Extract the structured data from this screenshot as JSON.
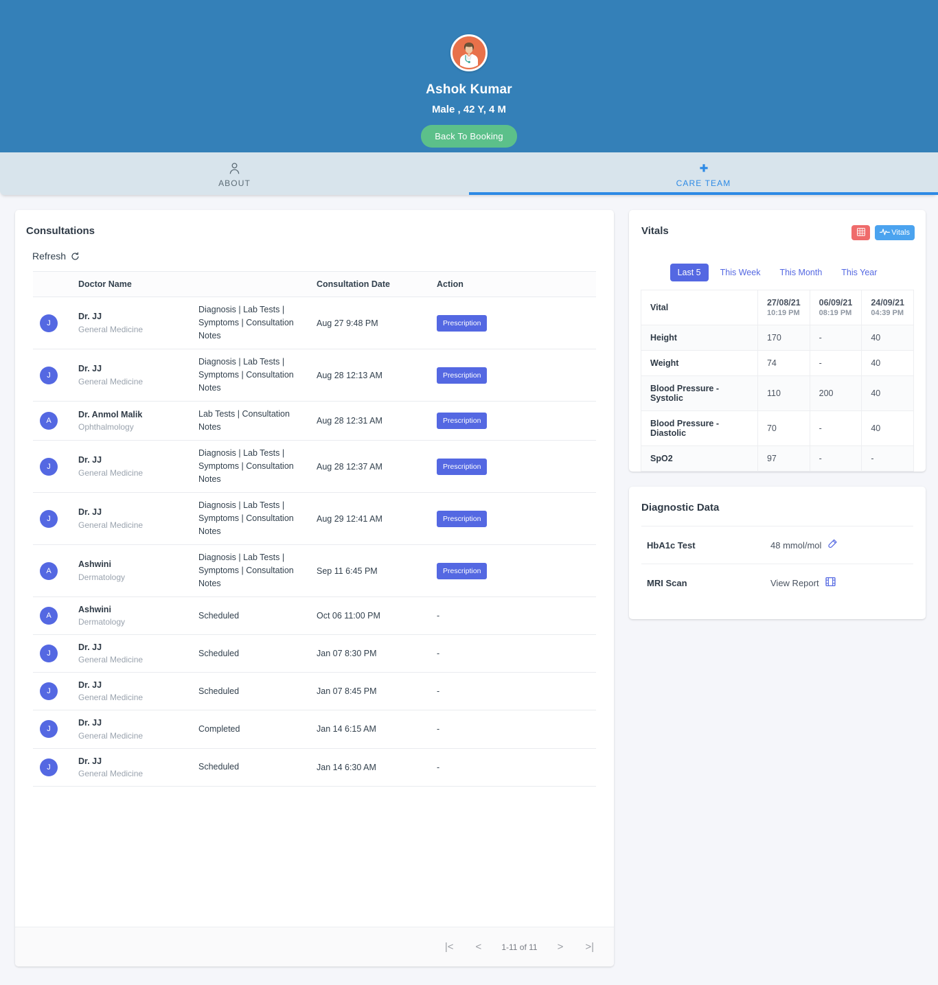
{
  "patient": {
    "avatar_icon": "doctor-avatar-icon",
    "name": "Ashok Kumar",
    "meta": "Male , 42 Y, 4 M",
    "back_button": "Back To Booking",
    "header_bg": "#3480b8",
    "button_bg": "#5cc08a"
  },
  "tabs": [
    {
      "label": "ABOUT",
      "icon": "person-icon",
      "active": false
    },
    {
      "label": "CARE TEAM",
      "icon": "plus-icon",
      "active": true
    }
  ],
  "consultations": {
    "title": "Consultations",
    "refresh_label": "Refresh",
    "refresh_icon": "refresh-icon",
    "columns": [
      "",
      "Doctor Name",
      "",
      "Consultation Date",
      "Action"
    ],
    "rows": [
      {
        "initial": "J",
        "doctor": "Dr. JJ",
        "specialty": "General Medicine",
        "tags": "Diagnosis | Lab Tests | Symptoms | Consultation Notes",
        "date": "Aug 27 9:48 PM",
        "action": "Prescription"
      },
      {
        "initial": "J",
        "doctor": "Dr. JJ",
        "specialty": "General Medicine",
        "tags": "Diagnosis | Lab Tests | Symptoms | Consultation Notes",
        "date": "Aug 28 12:13 AM",
        "action": "Prescription"
      },
      {
        "initial": "A",
        "doctor": "Dr. Anmol Malik",
        "specialty": "Ophthalmology",
        "tags": "Lab Tests | Consultation Notes",
        "date": "Aug 28 12:31 AM",
        "action": "Prescription"
      },
      {
        "initial": "J",
        "doctor": "Dr. JJ",
        "specialty": "General Medicine",
        "tags": "Diagnosis | Lab Tests | Symptoms | Consultation Notes",
        "date": "Aug 28 12:37 AM",
        "action": "Prescription"
      },
      {
        "initial": "J",
        "doctor": "Dr. JJ",
        "specialty": "General Medicine",
        "tags": "Diagnosis | Lab Tests | Symptoms | Consultation Notes",
        "date": "Aug 29 12:41 AM",
        "action": "Prescription"
      },
      {
        "initial": "A",
        "doctor": "Ashwini",
        "specialty": "Dermatology",
        "tags": "Diagnosis | Lab Tests | Symptoms | Consultation Notes",
        "date": "Sep 11 6:45 PM",
        "action": "Prescription"
      },
      {
        "initial": "A",
        "doctor": "Ashwini",
        "specialty": "Dermatology",
        "tags": "Scheduled",
        "date": "Oct 06 11:00 PM",
        "action": "-"
      },
      {
        "initial": "J",
        "doctor": "Dr. JJ",
        "specialty": "General Medicine",
        "tags": "Scheduled",
        "date": "Jan 07 8:30 PM",
        "action": "-"
      },
      {
        "initial": "J",
        "doctor": "Dr. JJ",
        "specialty": "General Medicine",
        "tags": "Scheduled",
        "date": "Jan 07 8:45 PM",
        "action": "-"
      },
      {
        "initial": "J",
        "doctor": "Dr. JJ",
        "specialty": "General Medicine",
        "tags": "Completed",
        "date": "Jan 14 6:15 AM",
        "action": "-"
      },
      {
        "initial": "J",
        "doctor": "Dr. JJ",
        "specialty": "General Medicine",
        "tags": "Scheduled",
        "date": "Jan 14 6:30 AM",
        "action": "-"
      }
    ],
    "paginator": {
      "first_icon": "first-page-icon",
      "prev_icon": "previous-page-icon",
      "range_label": "1-11 of 11",
      "next_icon": "next-page-icon",
      "last_icon": "last-page-icon"
    }
  },
  "vitals": {
    "title": "Vitals",
    "grid_button_icon": "grid-table-icon",
    "chart_button_label": "Vitals",
    "chart_button_icon": "pulse-icon",
    "range_tabs": [
      {
        "label": "Last 5",
        "selected": true
      },
      {
        "label": "This Week",
        "selected": false
      },
      {
        "label": "This Month",
        "selected": false
      },
      {
        "label": "This Year",
        "selected": false
      }
    ],
    "header_first": "Vital",
    "datetimes": [
      {
        "date": "27/08/21",
        "time": "10:19 PM"
      },
      {
        "date": "06/09/21",
        "time": "08:19 PM"
      },
      {
        "date": "24/09/21",
        "time": "04:39 PM"
      }
    ],
    "rows": [
      {
        "name": "Height",
        "values": [
          "170",
          "-",
          "40"
        ]
      },
      {
        "name": "Weight",
        "values": [
          "74",
          "-",
          "40"
        ]
      },
      {
        "name": "Blood Pressure - Systolic",
        "values": [
          "110",
          "200",
          "40"
        ]
      },
      {
        "name": "Blood Pressure - Diastolic",
        "values": [
          "70",
          "-",
          "40"
        ]
      },
      {
        "name": "SpO2",
        "values": [
          "97",
          "-",
          "-"
        ]
      }
    ]
  },
  "diagnostic": {
    "title": "Diagnostic Data",
    "rows": [
      {
        "name": "HbA1c Test",
        "value": "48 mmol/mol",
        "icon": "test-tube-icon"
      },
      {
        "name": "MRI Scan",
        "value": "View Report",
        "icon": "film-scan-icon"
      }
    ]
  }
}
